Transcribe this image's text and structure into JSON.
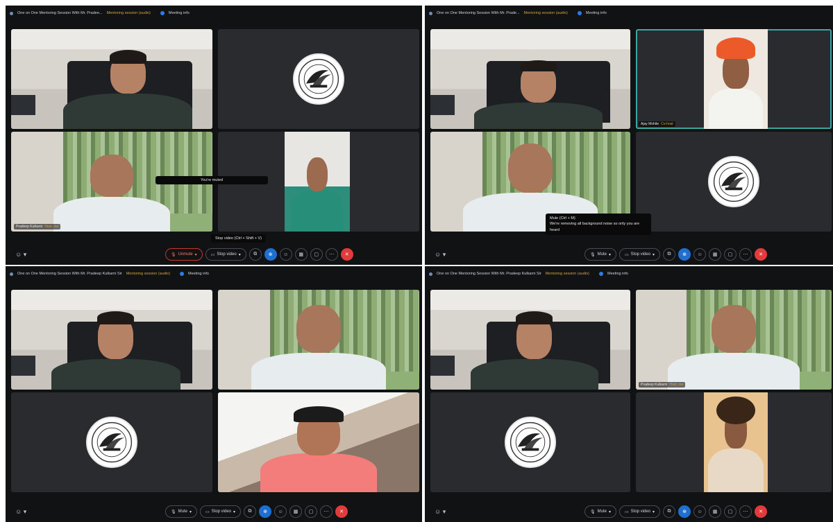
{
  "panels": [
    {
      "title": "One on One Mentoring Session With Mr. Pradee...",
      "title_badge": "Mentoring session (audio)",
      "info": "Meeting info",
      "tooltips": [
        "You're muted",
        "Stop video (Ctrl + Shift + V)"
      ],
      "controls": {
        "mic": "Unmute",
        "video": "Stop video"
      },
      "tiles": [
        {
          "kind": "room"
        },
        {
          "kind": "logo"
        },
        {
          "kind": "forest",
          "tag": "Pradeep Kulkarni",
          "tag_role": "Host, me"
        },
        {
          "kind": "teal"
        }
      ]
    },
    {
      "title": "One on One Mentoring Session With Mr. Prade...",
      "title_badge": "Mentoring session (audio)",
      "info": "Meeting info",
      "tooltips": [
        "Mute (Ctrl + M)",
        "We're removing all background noise so only you are heard"
      ],
      "controls": {
        "mic": "Mute",
        "video": "Stop video"
      },
      "tiles": [
        {
          "kind": "room"
        },
        {
          "kind": "turban",
          "tag": "Ajay Mohite",
          "tag_role": "Co-host"
        },
        {
          "kind": "forest2"
        },
        {
          "kind": "logo"
        }
      ]
    },
    {
      "title": "One on One Mentoring Session With Mr. Pradeep Kulkarni Sir",
      "title_badge": "Mentoring session (audio)",
      "info": "Meeting info",
      "tooltips": [],
      "controls": {
        "mic": "Mute",
        "video": "Stop video"
      },
      "tiles": [
        {
          "kind": "room"
        },
        {
          "kind": "forest2"
        },
        {
          "kind": "logo"
        },
        {
          "kind": "pink"
        }
      ]
    },
    {
      "title": "One on One Mentoring Session With Mr. Pradeep Kulkarni Sir",
      "title_badge": "Mentoring session (audio)",
      "info": "Meeting info",
      "tooltips": [],
      "controls": {
        "mic": "Mute",
        "video": "Stop video"
      },
      "tiles": [
        {
          "kind": "room"
        },
        {
          "kind": "forest2",
          "tag": "Pradeep Kulkarni",
          "tag_role": "Host, me"
        },
        {
          "kind": "logo"
        },
        {
          "kind": "curly"
        }
      ]
    }
  ],
  "colors": {
    "background": "#111214",
    "active_speaker": "#3aa7a0",
    "leave": "#e23b3b",
    "share": "#1f6fd1"
  }
}
